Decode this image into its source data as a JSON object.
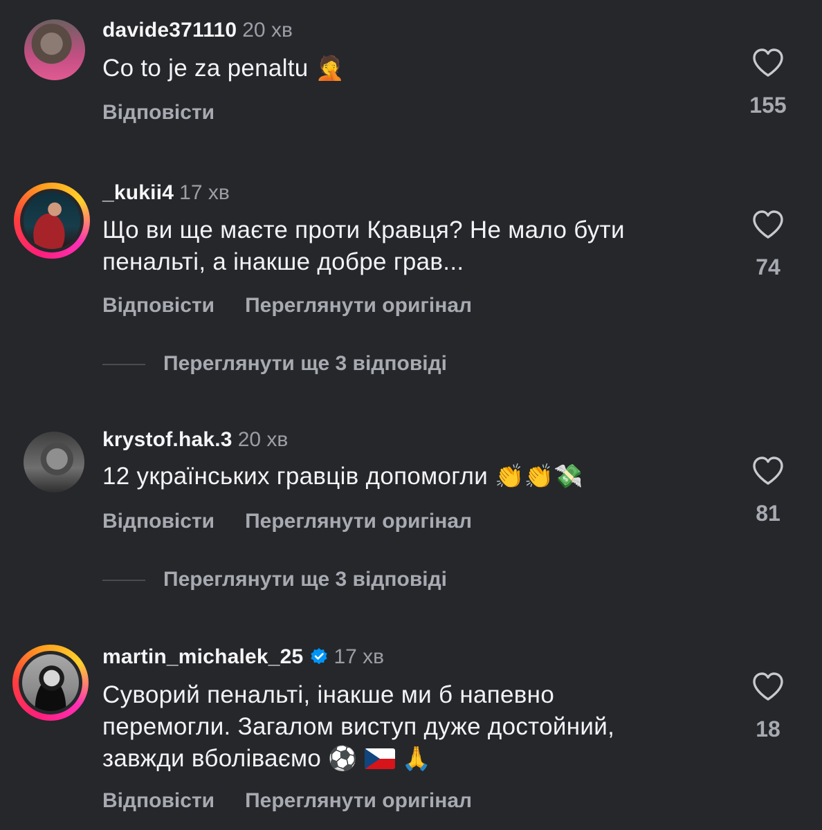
{
  "comments": [
    {
      "username": "davide371110",
      "time": "20 хв",
      "text_lines": [
        "Co to je za penaltu"
      ],
      "emoji": "🤦",
      "actions": [
        "Відповісти"
      ],
      "likes": "155"
    },
    {
      "username": "_kukii4",
      "time": "17 хв",
      "text_lines": [
        "Що ви ще маєте проти Кравця? Не мало бути",
        "пенальті, а інакше добре грав..."
      ],
      "actions": [
        "Відповісти",
        "Переглянути оригінал"
      ],
      "likes": "74",
      "view_replies": "Переглянути ще 3 відповіді"
    },
    {
      "username": "krystof.hak.3",
      "time": "20 хв",
      "text_lines": [
        "12 українських гравців допомогли"
      ],
      "emoji": "👏👏💸",
      "actions": [
        "Відповісти",
        "Переглянути оригінал"
      ],
      "likes": "81",
      "view_replies": "Переглянути ще 3 відповіді"
    },
    {
      "username": "martin_michalek_25",
      "verified": true,
      "time": "17 хв",
      "text_lines": [
        "Суворий пенальті, інакше ми б напевно",
        "перемогли. Загалом виступ дуже достойний,",
        "завжди вболіваємо"
      ],
      "emoji_ball": "⚽",
      "emoji_pray": "🙏",
      "actions": [
        "Відповісти",
        "Переглянути оригінал"
      ],
      "likes": "18"
    }
  ],
  "icons": {
    "heart": "heart-outline-icon",
    "verified": "verified-badge-icon",
    "flag": "czech-flag-icon"
  },
  "colors": {
    "background": "#25272b",
    "text": "#f3f3f5",
    "secondary": "#a8aab2",
    "verified": "#0095f6"
  }
}
